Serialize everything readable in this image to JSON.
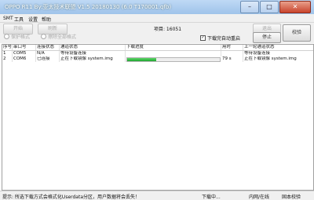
{
  "window": {
    "title": "OPPO R11 By:亚太技术联盟 V1.5 20180130 (6.0 T170001.qfb)",
    "min": "–",
    "max": "□",
    "close": "✕"
  },
  "menu": [
    "SMT",
    "工具",
    "设置",
    "帮助"
  ],
  "toolbar": {
    "start_label": "开始",
    "refresh_label": "刷新",
    "project_label": "项目: 16051",
    "exit_label": "退出",
    "stop_label": "停止",
    "verify_label": "校验",
    "auto_retry_label": "下载完自动重启",
    "auto_retry_checked": "✓"
  },
  "modes": [
    "保护格式",
    "擦除全部格式"
  ],
  "table": {
    "headers": [
      "序号",
      "串口号",
      "连接状态",
      "通道状态",
      "下载进度",
      "用时",
      "上一轮通道状态"
    ],
    "rows": [
      {
        "no": "1",
        "port": "COM5",
        "conn": "N/A",
        "channel": "等待设备连接",
        "progress": 0,
        "time": "",
        "last": "等待设备连接"
      },
      {
        "no": "2",
        "port": "COM6",
        "conn": "已连接",
        "channel": "正在下载镜像 system.img",
        "progress": 0.31,
        "time": "79 s",
        "last": "正在下载镜像 system.img"
      }
    ]
  },
  "status": {
    "message": "提示: 所选下载方式会格式化Userdata分区，用户数据将会丢失！",
    "state": "下载中...",
    "mode": "内网/在线",
    "tail": "固本校验"
  },
  "colors": {
    "progress": "#1ea52e",
    "titlebar": "#9fc3ea"
  }
}
